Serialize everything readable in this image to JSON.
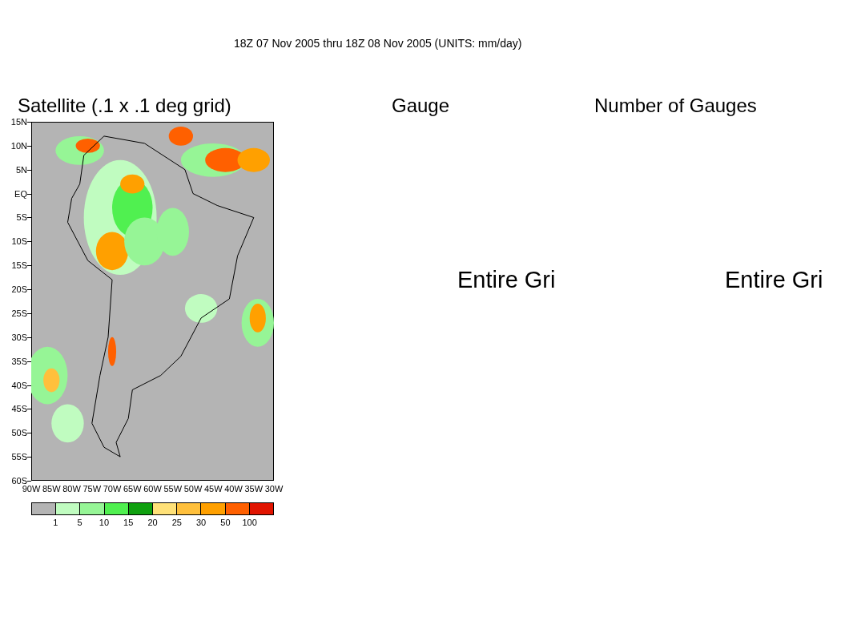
{
  "header": "18Z 07 Nov 2005 thru 18Z 08 Nov 2005 (UNITS: mm/day)",
  "panels": [
    {
      "title": "Satellite (.1 x .1 deg grid)",
      "kind": "map"
    },
    {
      "title": "Gauge",
      "kind": "message",
      "message": "Entire Gri"
    },
    {
      "title": "Number of Gauges",
      "kind": "message",
      "message": "Entire Gri"
    }
  ],
  "lat_labels": [
    "15N",
    "10N",
    "5N",
    "EQ",
    "5S",
    "10S",
    "15S",
    "20S",
    "25S",
    "30S",
    "35S",
    "40S",
    "45S",
    "50S",
    "55S",
    "60S"
  ],
  "lon_labels": [
    "90W",
    "85W",
    "80W",
    "75W",
    "70W",
    "65W",
    "60W",
    "55W",
    "50W",
    "45W",
    "40W",
    "35W",
    "30W"
  ],
  "legend": {
    "swatches": [
      {
        "color": "#b4b4b4"
      },
      {
        "color": "#c0fcc0"
      },
      {
        "color": "#96f596"
      },
      {
        "color": "#50f050"
      },
      {
        "color": "#0fa00f"
      },
      {
        "color": "#ffe178"
      },
      {
        "color": "#ffc03c"
      },
      {
        "color": "#ffa000"
      },
      {
        "color": "#ff6000"
      },
      {
        "color": "#e11400"
      }
    ],
    "labels": [
      "1",
      "5",
      "10",
      "15",
      "20",
      "25",
      "30",
      "50",
      "100"
    ]
  }
}
